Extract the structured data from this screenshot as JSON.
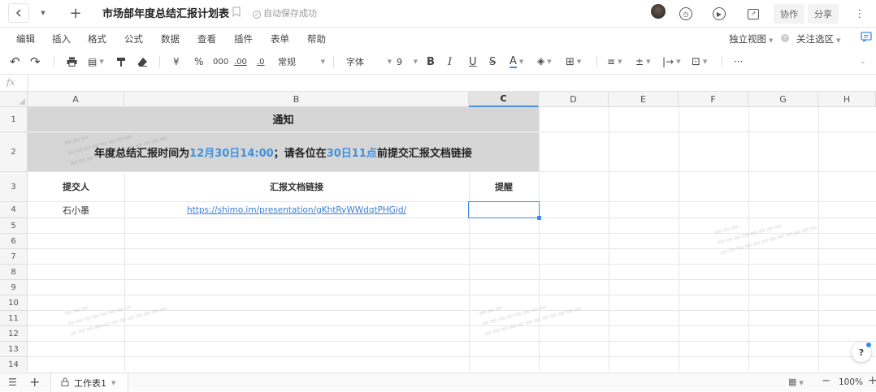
{
  "titlebar": {
    "doc_title": "市场部年度总结汇报计划表",
    "save_status": "自动保存成功",
    "collab_label": "协作",
    "share_label": "分享"
  },
  "menubar": {
    "items": [
      "编辑",
      "插入",
      "格式",
      "公式",
      "数据",
      "查看",
      "插件",
      "表单",
      "帮助"
    ],
    "view_mode": "独立视图",
    "follow_label": "关注选区"
  },
  "toolbar": {
    "currency": "¥",
    "percent": "%",
    "thousands": "000",
    "dec_add": ".00",
    "dec_remove": ".0",
    "number_format": "常规",
    "font_name": "字体",
    "font_size": "9",
    "bold": "B",
    "italic": "I",
    "underline": "U",
    "strike": "S",
    "font_color_letter": "A",
    "more": "···"
  },
  "formula": {
    "fx_label": "fx",
    "value": ""
  },
  "grid": {
    "columns": [
      "A",
      "B",
      "C",
      "D",
      "E",
      "F",
      "G",
      "H"
    ],
    "rows": [
      "1",
      "2",
      "3",
      "4",
      "5",
      "6",
      "7",
      "8",
      "9",
      "10",
      "11",
      "12",
      "13",
      "14"
    ],
    "notice_title": "通知",
    "notice_part1": "年度总结汇报时间为",
    "notice_date": "12月30日14:00",
    "notice_part2": "；请各位在",
    "notice_deadline": "30日11点",
    "notice_part3": "前提交汇报文档链接",
    "headers": {
      "submitter": "提交人",
      "link": "汇报文档链接",
      "reminder": "提醒"
    },
    "rows_data": [
      {
        "submitter": "石小墨",
        "link": "https://shimo.im/presentation/gKhtRyWWdqtPHGjd/",
        "reminder": ""
      }
    ],
    "accent_color": "#3e92e0"
  },
  "bottombar": {
    "sheet_name": "工作表1",
    "zoom": "100%",
    "minus": "−",
    "plus": "+"
  }
}
